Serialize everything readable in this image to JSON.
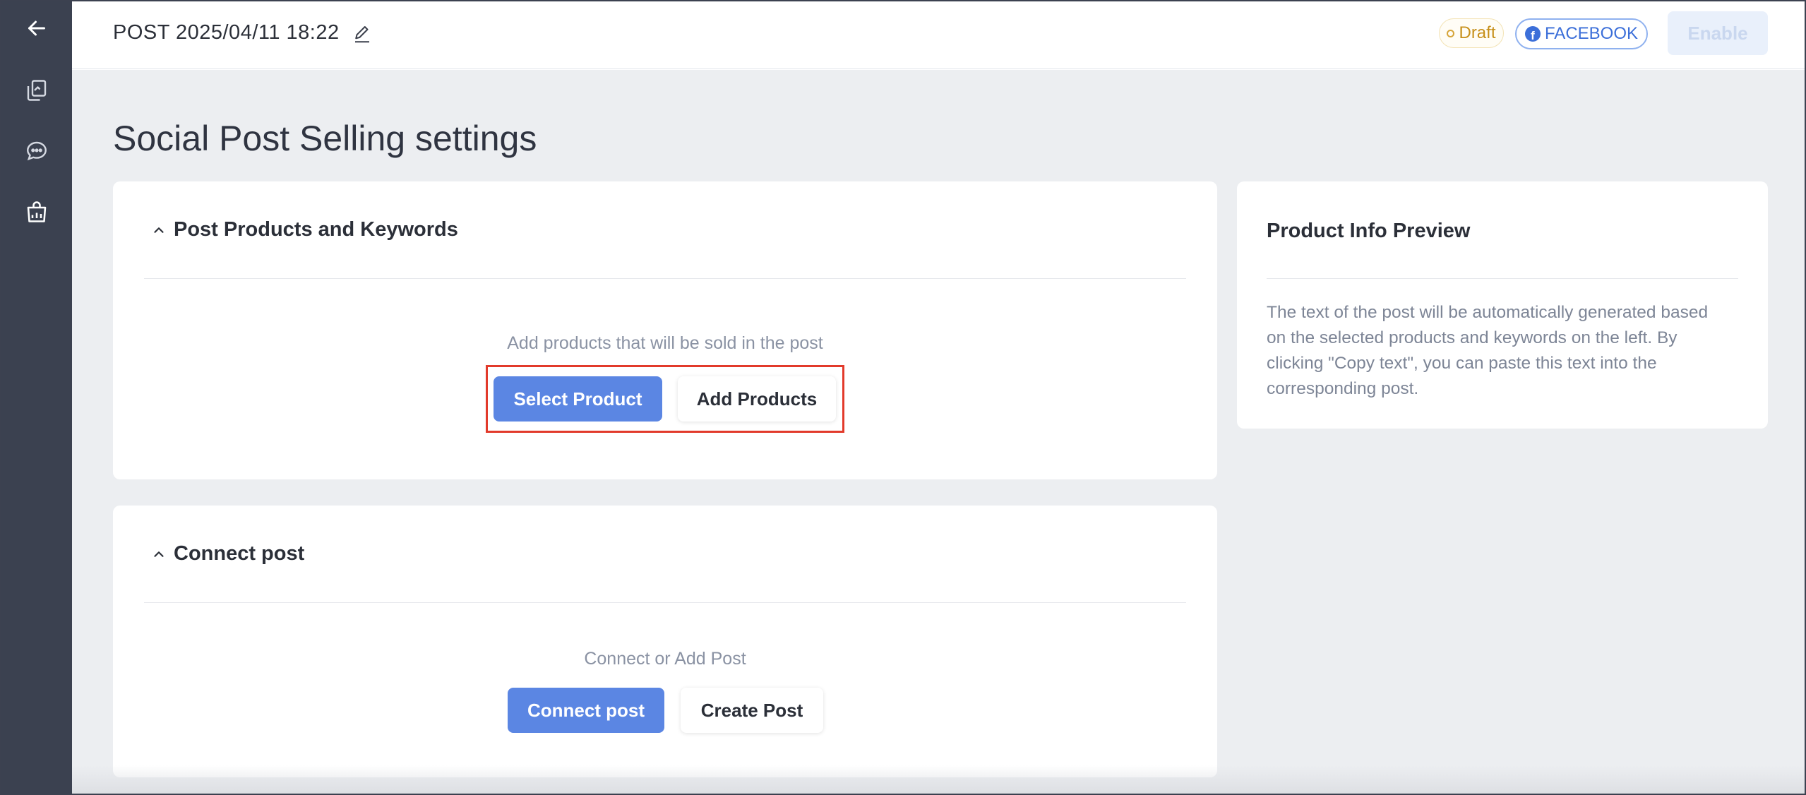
{
  "topbar": {
    "post_title": "POST 2025/04/11 18:22",
    "draft_label": "Draft",
    "platform_label": "FACEBOOK",
    "enable_label": "Enable"
  },
  "sidebar": {
    "items": [
      {
        "icon": "back-arrow-icon"
      },
      {
        "icon": "posts-icon"
      },
      {
        "icon": "chat-icon"
      },
      {
        "icon": "shop-analytics-icon"
      }
    ]
  },
  "main": {
    "page_title": "Social Post Selling settings",
    "products_section": {
      "title": "Post Products and Keywords",
      "hint": "Add products that will be sold in the post",
      "select_button": "Select Product",
      "add_button": "Add Products"
    },
    "connect_section": {
      "title": "Connect post",
      "hint": "Connect or Add Post",
      "connect_button": "Connect post",
      "create_button": "Create Post"
    },
    "preview": {
      "title": "Product Info Preview",
      "text": "The text of the post will be automatically generated based on the selected products and keywords on the left. By clicking \"Copy text\", you can paste this text into the corresponding post."
    }
  },
  "colors": {
    "sidebar": "#3b4150",
    "primary": "#5b86e3",
    "highlight": "#e23a2b",
    "draft": "#c7901a",
    "facebook": "#3c6fd9"
  }
}
